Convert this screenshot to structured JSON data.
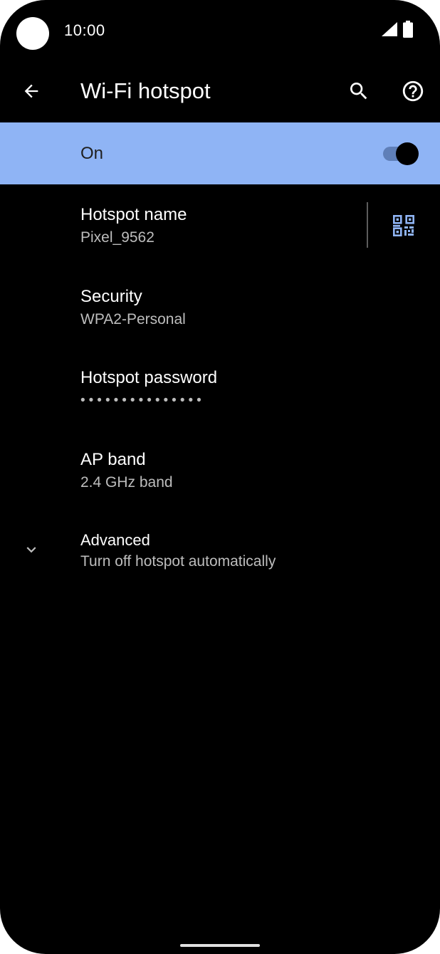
{
  "status_bar": {
    "time": "10:00"
  },
  "app_bar": {
    "title": "Wi-Fi hotspot",
    "back_icon": "arrow-back-icon",
    "search_icon": "search-icon",
    "help_icon": "help-circle-icon"
  },
  "master_switch": {
    "label": "On",
    "checked": true
  },
  "items": {
    "hotspot_name": {
      "title": "Hotspot name",
      "summary": "Pixel_9562",
      "action_icon": "qr-code-icon"
    },
    "security": {
      "title": "Security",
      "summary": "WPA2-Personal"
    },
    "password": {
      "title": "Hotspot password",
      "summary": "•••••••••••••••"
    },
    "ap_band": {
      "title": "AP band",
      "summary": "2.4 GHz band"
    },
    "advanced": {
      "title": "Advanced",
      "summary": "Turn off hotspot automatically",
      "icon": "chevron-down-icon"
    }
  },
  "colors": {
    "background": "#000000",
    "accent_bar": "#8fb4f5",
    "qr_icon": "#8fb4f5",
    "summary_text": "#bdbdbd"
  }
}
